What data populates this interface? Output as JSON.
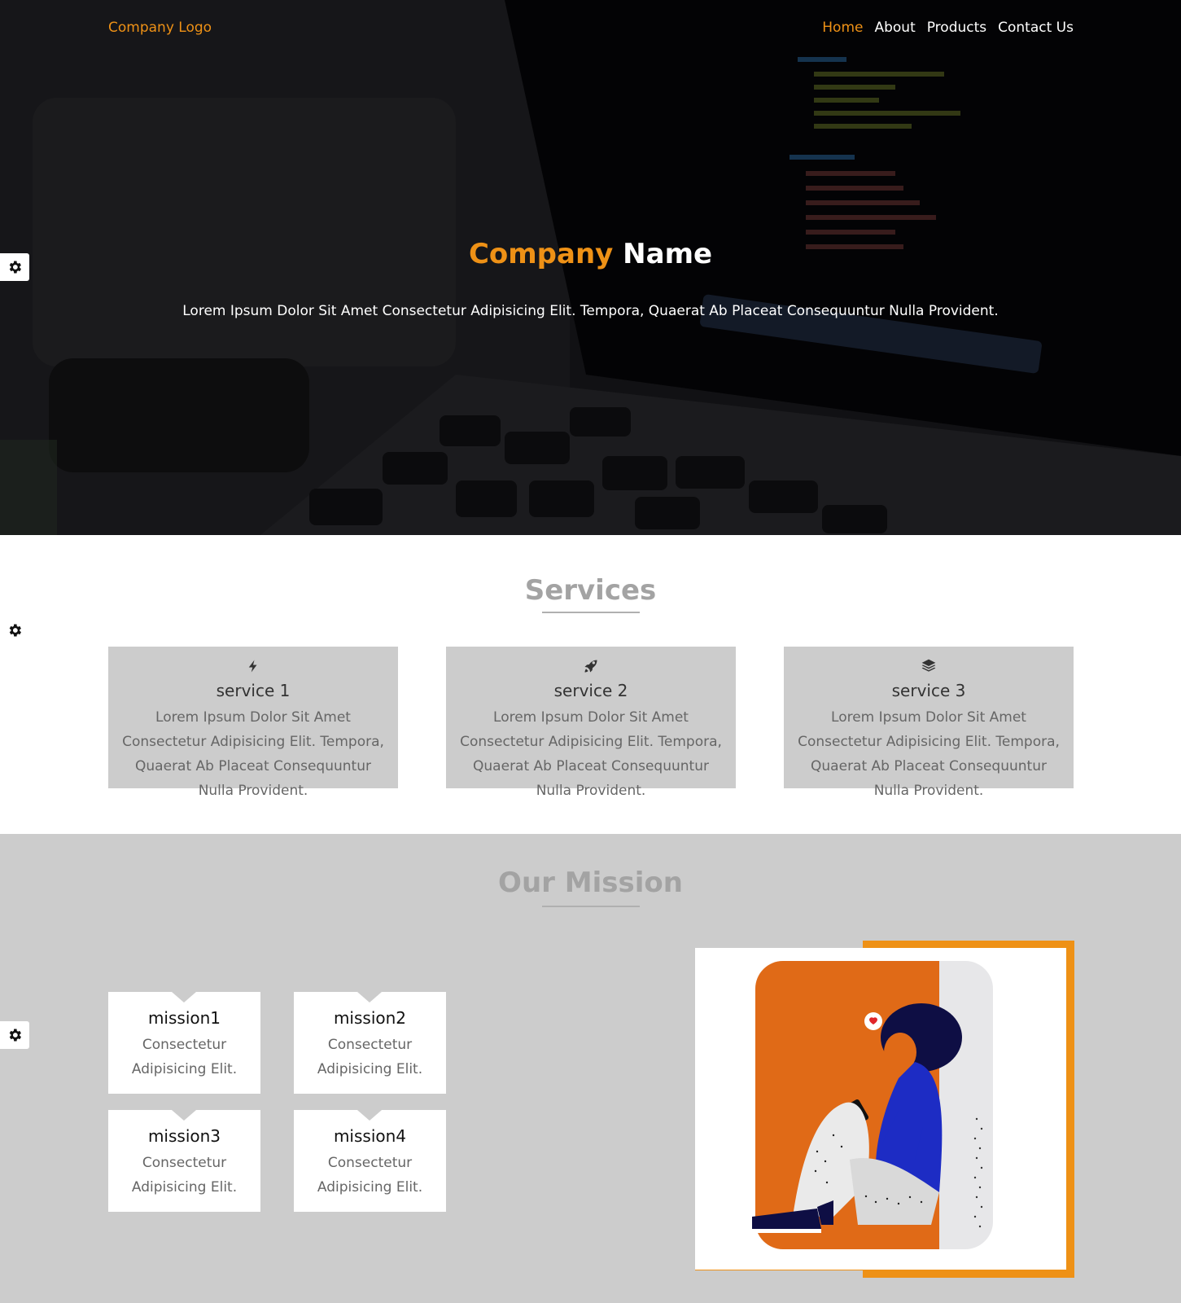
{
  "header": {
    "logo": "Company Logo",
    "nav": [
      {
        "label": "Home",
        "active": true
      },
      {
        "label": "About",
        "active": false
      },
      {
        "label": "Products",
        "active": false
      },
      {
        "label": "Contact Us",
        "active": false
      }
    ]
  },
  "hero": {
    "title_part1": "Company",
    "title_part2": "Name",
    "subtitle": "Lorem Ipsum Dolor Sit Amet Consectetur Adipisicing Elit. Tempora, Quaerat Ab Placeat Consequuntur Nulla Provident."
  },
  "services": {
    "title": "Services",
    "items": [
      {
        "icon": "bolt-icon",
        "title": "service 1",
        "desc": "Lorem Ipsum Dolor Sit Amet Consectetur Adipisicing Elit. Tempora, Quaerat Ab Placeat Consequuntur Nulla Provident."
      },
      {
        "icon": "rocket-icon",
        "title": "service 2",
        "desc": "Lorem Ipsum Dolor Sit Amet Consectetur Adipisicing Elit. Tempora, Quaerat Ab Placeat Consequuntur Nulla Provident."
      },
      {
        "icon": "layers-icon",
        "title": "service 3",
        "desc": "Lorem Ipsum Dolor Sit Amet Consectetur Adipisicing Elit. Tempora, Quaerat Ab Placeat Consequuntur Nulla Provident."
      }
    ]
  },
  "mission": {
    "title": "Our Mission",
    "items": [
      {
        "title": "mission1",
        "desc": "Consectetur Adipisicing Elit."
      },
      {
        "title": "mission2",
        "desc": "Consectetur Adipisicing Elit."
      },
      {
        "title": "mission3",
        "desc": "Consectetur Adipisicing Elit."
      },
      {
        "title": "mission4",
        "desc": "Consectetur Adipisicing Elit."
      }
    ]
  },
  "colors": {
    "accent": "#ee9116",
    "card_gray": "#cccccc",
    "heading_gray": "#a3a3a3"
  }
}
